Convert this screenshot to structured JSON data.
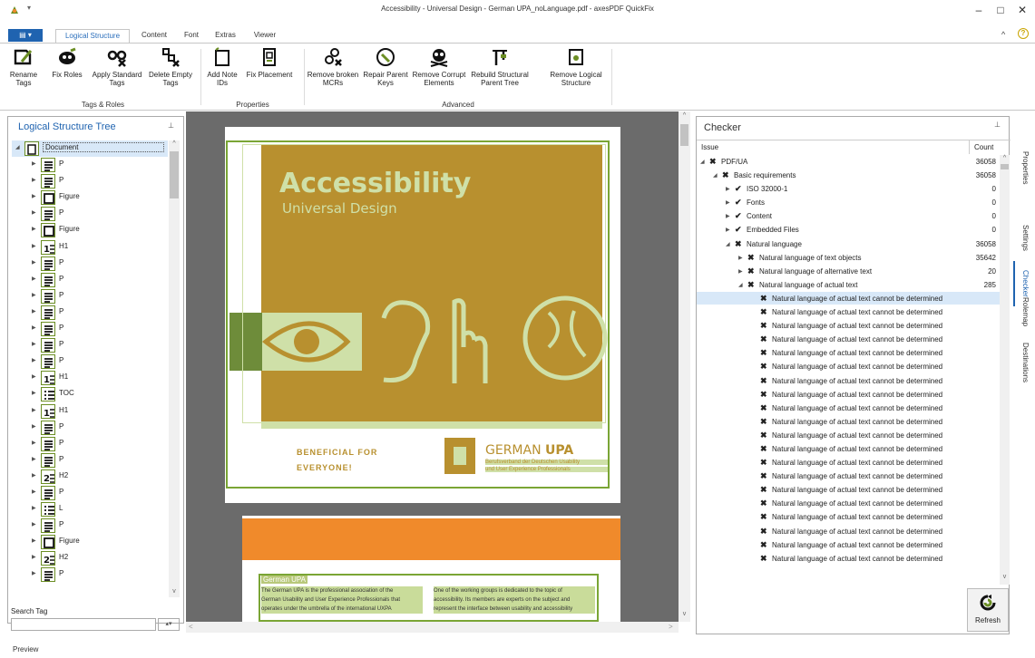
{
  "window": {
    "title": "Accessibility - Universal Design - German UPA_noLanguage.pdf - axesPDF QuickFix",
    "minimize": "–",
    "maximize": "□",
    "close": "✕"
  },
  "tabs": [
    "Logical Structure",
    "Content",
    "Font",
    "Extras",
    "Viewer"
  ],
  "ribbon": {
    "buttons": [
      {
        "label": "Rename Tags",
        "icon": "rename-tags-icon"
      },
      {
        "label": "Fix Roles",
        "icon": "fix-roles-icon"
      },
      {
        "label": "Apply Standard Tags",
        "icon": "apply-standard-tags-icon"
      },
      {
        "label": "Delete Empty Tags",
        "icon": "delete-empty-tags-icon"
      },
      {
        "label": "Add Note IDs",
        "icon": "add-note-ids-icon"
      },
      {
        "label": "Fix Placement",
        "icon": "fix-placement-icon"
      },
      {
        "label": "Remove broken MCRs",
        "icon": "remove-broken-mcrs-icon"
      },
      {
        "label": "Repair Parent Keys",
        "icon": "repair-parent-keys-icon"
      },
      {
        "label": "Remove Corrupt Elements",
        "icon": "remove-corrupt-elements-icon"
      },
      {
        "label": "Rebuild Structural Parent Tree",
        "icon": "rebuild-parent-tree-icon"
      },
      {
        "label": "Remove Logical Structure",
        "icon": "remove-logical-structure-icon"
      }
    ],
    "groups": [
      "Tags & Roles",
      "Properties",
      "Advanced"
    ]
  },
  "left_panel": {
    "title": "Logical Structure Tree",
    "search_label": "Search Tag",
    "search_value": "",
    "tree": [
      {
        "label": "Document",
        "kind": "doc"
      },
      {
        "label": "P",
        "kind": "p"
      },
      {
        "label": "P",
        "kind": "p"
      },
      {
        "label": "Figure",
        "kind": "fig"
      },
      {
        "label": "P",
        "kind": "p"
      },
      {
        "label": "Figure",
        "kind": "fig"
      },
      {
        "label": "H1",
        "kind": "h1"
      },
      {
        "label": "P",
        "kind": "p"
      },
      {
        "label": "P",
        "kind": "p"
      },
      {
        "label": "P",
        "kind": "p"
      },
      {
        "label": "P",
        "kind": "p"
      },
      {
        "label": "P",
        "kind": "p"
      },
      {
        "label": "P",
        "kind": "p"
      },
      {
        "label": "P",
        "kind": "p"
      },
      {
        "label": "H1",
        "kind": "h1"
      },
      {
        "label": "TOC",
        "kind": "toc"
      },
      {
        "label": "H1",
        "kind": "h1"
      },
      {
        "label": "P",
        "kind": "p"
      },
      {
        "label": "P",
        "kind": "p"
      },
      {
        "label": "P",
        "kind": "p"
      },
      {
        "label": "H2",
        "kind": "h2"
      },
      {
        "label": "P",
        "kind": "p"
      },
      {
        "label": "L",
        "kind": "l"
      },
      {
        "label": "P",
        "kind": "p"
      },
      {
        "label": "Figure",
        "kind": "fig"
      },
      {
        "label": "H2",
        "kind": "h2"
      },
      {
        "label": "P",
        "kind": "p"
      }
    ]
  },
  "document": {
    "cover_title": "Accessibility",
    "cover_subtitle": "Universal Design",
    "beneficial_line1": "BENEFICIAL FOR",
    "beneficial_line2": "EVERYONE!",
    "upa_logo_text1": "GERMAN ",
    "upa_logo_text2": "UPA",
    "upa_tag_line1": "Berufsverband der Deutschen Usability",
    "upa_tag_line2": "und User Experience Professionals",
    "page2_heading": "German UPA",
    "page2_col1": [
      "The German UPA is the professional association of the",
      "German Usability and User Experience Professionals that",
      "operates under the umbrella of the international UXPA"
    ],
    "page2_col2": [
      "One of the working groups is dedicated to the topic of",
      "accessibility. Its members are experts on the subject and",
      "represent the interface between usability and accessibility"
    ]
  },
  "checker": {
    "title": "Checker",
    "col_issue": "Issue",
    "col_count": "Count",
    "rows": [
      {
        "label": "PDF/UA",
        "count": "36058",
        "level": 0,
        "status": "fail",
        "expander": "open"
      },
      {
        "label": "Basic requirements",
        "count": "36058",
        "level": 1,
        "status": "fail",
        "expander": "open"
      },
      {
        "label": "ISO 32000-1",
        "count": "0",
        "level": 2,
        "status": "pass",
        "expander": "closed"
      },
      {
        "label": "Fonts",
        "count": "0",
        "level": 2,
        "status": "pass",
        "expander": "closed"
      },
      {
        "label": "Content",
        "count": "0",
        "level": 2,
        "status": "pass",
        "expander": "closed"
      },
      {
        "label": "Embedded Files",
        "count": "0",
        "level": 2,
        "status": "pass",
        "expander": "closed"
      },
      {
        "label": "Natural language",
        "count": "36058",
        "level": 2,
        "status": "fail",
        "expander": "open"
      },
      {
        "label": "Natural language of text objects",
        "count": "35642",
        "level": 3,
        "status": "fail",
        "expander": "closed"
      },
      {
        "label": "Natural language of alternative text",
        "count": "20",
        "level": 3,
        "status": "fail",
        "expander": "closed"
      },
      {
        "label": "Natural language of actual text",
        "count": "285",
        "level": 3,
        "status": "fail",
        "expander": "open"
      }
    ],
    "leaf_label": "Natural language of actual text cannot be determined",
    "leaf_count": 20,
    "refresh_label": "Refresh",
    "side_tabs": [
      "Properties",
      "Settings",
      "Checker",
      "Rolemap",
      "Destinations"
    ]
  },
  "status_bar": {
    "text": "Preview"
  },
  "colors": {
    "accent": "#1f63b0",
    "tag_green": "#6b8e23",
    "cover_bg": "#b8902f",
    "cover_art": "#cfe0a8",
    "orange": "#f08a2b",
    "highlight": "#d8e8f8"
  }
}
